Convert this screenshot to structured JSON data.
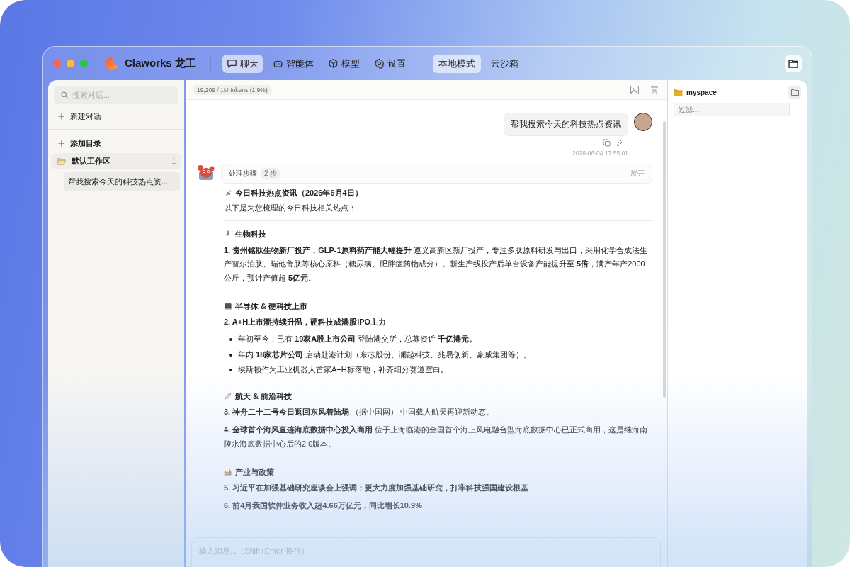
{
  "window": {
    "app_name": "Claworks 龙工"
  },
  "nav": [
    {
      "label": "聊天",
      "selected": true
    },
    {
      "label": "智能体",
      "selected": false
    },
    {
      "label": "模型",
      "selected": false
    },
    {
      "label": "设置",
      "selected": false
    }
  ],
  "modes": [
    {
      "label": "本地模式",
      "selected": true
    },
    {
      "label": "云沙箱",
      "selected": false
    }
  ],
  "sidebar": {
    "search": {
      "placeholder": "搜索对话..."
    },
    "new_chat": "新建对话",
    "add_folder": "添加目录",
    "folders": [
      {
        "name": "默认工作区",
        "count": "1",
        "expanded": true,
        "children": [
          {
            "title": "帮我搜索今天的科技热点资...",
            "selected": true
          }
        ]
      }
    ]
  },
  "chat": {
    "tokens_used": "19,209",
    "tokens_limit": "/ 1M",
    "tokens_unit": "tokens (1.9%)",
    "user_message": {
      "text": "帮我搜索今天的科技热点资讯",
      "time": "2026-06-04 17:55:01"
    },
    "steps": {
      "label": "处理步骤",
      "count": "2 步",
      "toggle": "展开"
    },
    "blocks": [
      {
        "kind": "title",
        "text": "今日科技热点资讯（2026年6月4日）"
      },
      {
        "kind": "text",
        "text": "以下是为您梳理的今日科技相关热点："
      },
      {
        "kind": "divider"
      },
      {
        "kind": "heading",
        "text": "生物科技"
      },
      {
        "kind": "item",
        "title": "1. 贵州铭肽生物新厂投产，GLP-1原料药产能大幅提升",
        "detail": "遵义高新区新厂投产，专注多肽原料研发与出口，采用化学合成法生产替尔泊肽、瑞他鲁肽等核心原料（糖尿病、肥胖症药物成分）。新生产线投产后单台设备产能提升至 **5倍**，满产年产2000公斤，预计产值超 **5亿元**。"
      },
      {
        "kind": "divider"
      },
      {
        "kind": "heading",
        "text": "半导体 & 硬科技上市"
      },
      {
        "kind": "item",
        "title": "2. A+H上市潮持续升温，硬科技成港股IPO主力"
      },
      {
        "kind": "bullet",
        "text": "年初至今，已有 **19家A股上市公司** 登陆港交所，总募资近 **千亿港元。**"
      },
      {
        "kind": "bullet",
        "text": "年内 **18家芯片公司** 启动赴港计划（东芯股份、澜起科技、兆易创新、豪威集团等）。"
      },
      {
        "kind": "bullet",
        "text": "埃斯顿作为工业机器人首家A+H标落地，补齐细分赛道空白。"
      },
      {
        "kind": "divider"
      },
      {
        "kind": "heading",
        "text": "航天 & 前沿科技"
      },
      {
        "kind": "item",
        "title": "3. 神舟二十二号今日返回东风着陆场",
        "detail": "（据中国网） 中国载人航天再迎新动态。"
      },
      {
        "kind": "item",
        "title": "4. 全球首个海风直连海底数据中心投入商用",
        "detail": "位于上海临港的全国首个海上风电融合型海底数据中心已正式商用，这是继海南陵水海底数据中心后的2.0版本。"
      },
      {
        "kind": "divider"
      },
      {
        "kind": "heading",
        "text": "产业与政策"
      },
      {
        "kind": "item",
        "title": "5. 习近平在加强基础研究座谈会上强调：更大力度加强基础研究，打牢科技强国建设根基"
      },
      {
        "kind": "item",
        "title": "6. 前4月我国软件业务收入超4.66万亿元，同比增长10.9%"
      }
    ],
    "input": {
      "placeholder": "输入消息...（Shift+Enter 换行）"
    }
  },
  "right_panel": {
    "folder": "myspace",
    "filter": {
      "placeholder": "过滤..."
    }
  }
}
